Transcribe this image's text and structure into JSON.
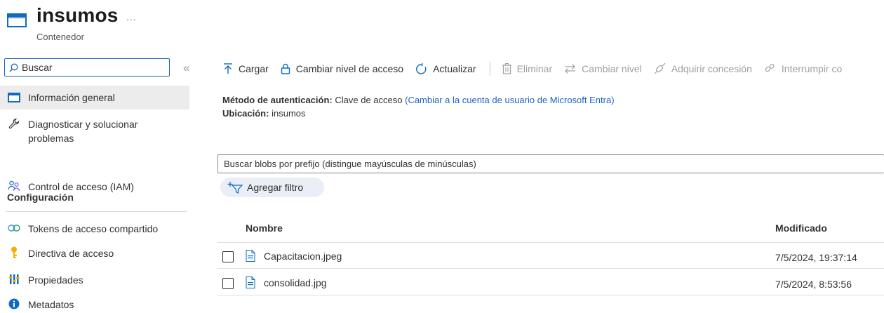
{
  "header": {
    "title": "insumos",
    "more_label": "...",
    "subtitle": "Contenedor"
  },
  "sidebar": {
    "search_placeholder": "Buscar",
    "collapse_label": "«",
    "items": [
      {
        "label": "Información general",
        "icon": "overview-icon",
        "selected": true
      },
      {
        "label": "Diagnosticar y solucionar problemas",
        "icon": "wrench-icon"
      },
      {
        "label": "Control de acceso (IAM)",
        "icon": "people-icon"
      },
      {
        "label": "Tokens de acceso compartido",
        "icon": "link-icon"
      },
      {
        "label": "Directiva de acceso",
        "icon": "key-icon"
      },
      {
        "label": "Propiedades",
        "icon": "properties-icon"
      },
      {
        "label": "Metadatos",
        "icon": "info-icon"
      }
    ],
    "section_configuracion": "Configuración"
  },
  "toolbar": {
    "items": [
      {
        "label": "Cargar",
        "icon": "upload-icon",
        "enabled": true
      },
      {
        "label": "Cambiar nivel de acceso",
        "icon": "lock-icon",
        "enabled": true
      },
      {
        "label": "Actualizar",
        "icon": "refresh-icon",
        "enabled": true
      },
      {
        "label": "Eliminar",
        "icon": "trash-icon",
        "enabled": false
      },
      {
        "label": "Cambiar nivel",
        "icon": "swap-icon",
        "enabled": false
      },
      {
        "label": "Adquirir concesión",
        "icon": "lease-icon",
        "enabled": false
      },
      {
        "label": "Interrumpir co",
        "icon": "break-lease-icon",
        "enabled": false
      }
    ]
  },
  "info": {
    "auth_label": "Método de autenticación:",
    "auth_value": "Clave de acceso",
    "auth_link": "(Cambiar a la cuenta de usuario de Microsoft Entra)",
    "location_label": "Ubicación:",
    "location_value": "insumos"
  },
  "blob_search": {
    "placeholder": "Buscar blobs por prefijo (distingue mayúsculas de minúsculas)"
  },
  "filter": {
    "label": "Agregar filtro"
  },
  "table": {
    "columns": [
      "Nombre",
      "Modificado"
    ],
    "rows": [
      {
        "name": "Capacitacion.jpeg",
        "modified": "7/5/2024, 19:37:14"
      },
      {
        "name": "consolidad.jpg",
        "modified": "7/5/2024, 8:53:56"
      }
    ]
  },
  "colors": {
    "accent": "#1e63c4",
    "selected_bg": "#ececec",
    "disabled": "#a19f9d"
  }
}
